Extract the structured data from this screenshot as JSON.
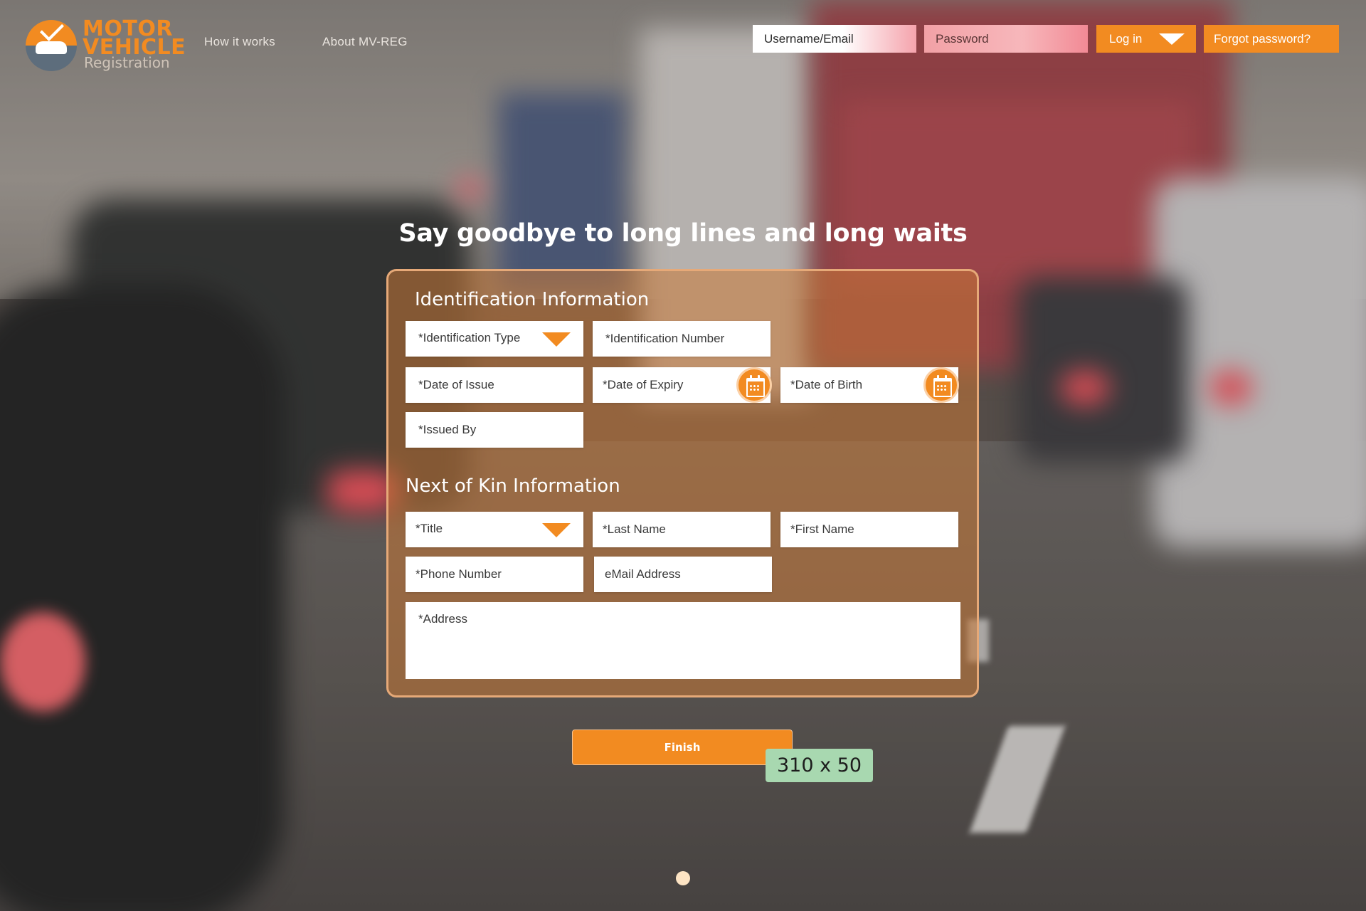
{
  "logo": {
    "line1": "MOTOR",
    "line2": "VEHICLE",
    "line3": "Registration"
  },
  "nav": {
    "how_it_works": "How it works",
    "about": "About MV-REG"
  },
  "header": {
    "username_placeholder": "Username/Email",
    "password_placeholder": "Password",
    "login_label": "Log in",
    "forgot_label": "Forgot password?"
  },
  "hero": {
    "title": "Say goodbye to long lines and long waits"
  },
  "identification": {
    "title": "Identification Information",
    "id_type": "*Identification Type",
    "id_number": "*Identification Number",
    "date_of_issue": "*Date of Issue",
    "date_of_expiry": "*Date of Expiry",
    "date_of_birth": "*Date of Birth",
    "issued_by": "*Issued By"
  },
  "next_of_kin": {
    "title": "Next of Kin Information",
    "title_select": "*Title",
    "last_name": "*Last Name",
    "first_name": "*First Name",
    "phone": "*Phone Number",
    "email": "eMail Address",
    "address": "*Address"
  },
  "finish": {
    "label": "Finish",
    "dimension_label": "310 x 50"
  },
  "colors": {
    "accent": "#f28b21",
    "panel": "#c87837",
    "dimension_tag": "#a8d8b0"
  },
  "icons": [
    "calendar-icon",
    "chevron-down-icon"
  ]
}
